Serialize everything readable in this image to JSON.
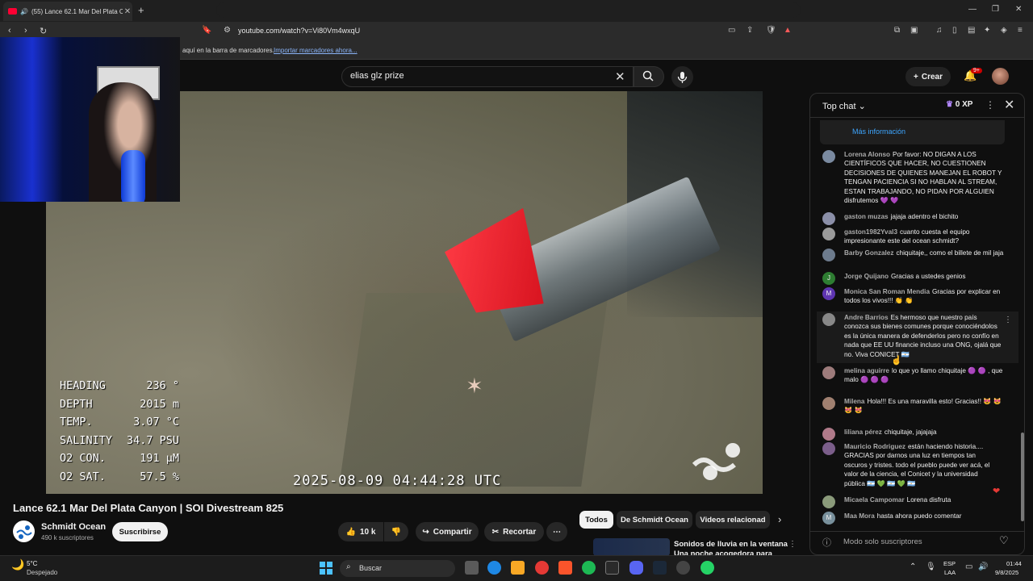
{
  "browser": {
    "tab_title": "(55) Lance 62.1 Mar Del Plata C",
    "url": "youtube.com/watch?v=Vi80Vm4wxqU",
    "bookmarks_text": "aquí en la barra de marcadores.",
    "bookmarks_link": "Importar marcadores ahora..."
  },
  "header": {
    "search_query": "elias glz prize",
    "create_label": "Crear",
    "notifications_badge": "9+"
  },
  "video": {
    "telemetry": [
      {
        "label": "HEADING",
        "value": "236 °"
      },
      {
        "label": "DEPTH",
        "value": "2015 m"
      },
      {
        "label": "TEMP.",
        "value": "3.07 °C"
      },
      {
        "label": "SALINITY",
        "value": "34.7 PSU"
      },
      {
        "label": "O2 CON.",
        "value": "191 µM"
      },
      {
        "label": "O2 SAT.",
        "value": "57.5 %"
      }
    ],
    "timestamp": "2025-08-09 04:44:28 UTC",
    "title": "Lance 62.1 Mar Del Plata Canyon | SOI Divestream 825",
    "channel_name": "Schmidt Ocean",
    "subscribers": "490 k suscriptores",
    "subscribe_label": "Suscribirse",
    "likes": "10 k",
    "share_label": "Compartir",
    "clip_label": "Recortar"
  },
  "chips": [
    "Todos",
    "De Schmidt Ocean",
    "Videos relacionad"
  ],
  "recommended": {
    "title": "Sonidos de lluvia en la ventana",
    "subtitle": "Una noche acogedora para"
  },
  "chat": {
    "title": "Top chat",
    "xp": "0 XP",
    "more_info": "Más información",
    "footer": "Modo solo suscriptores",
    "messages": [
      {
        "author": "Lorena Alonso",
        "text": "Por favor: NO DIGAN A LOS CIENTÍFICOS QUE HACER, NO CUESTIONEN DECISIONES DE QUIENES MANEJAN EL ROBOT Y TENGAN PACIENCIA SI NO HABLAN AL STREAM, ESTAN TRABAJANDO, NO PIDAN POR ALGUIEN disfrutemos 💜 💜",
        "avatar": "#7a8aa0"
      },
      {
        "author": "gaston muzas",
        "text": "jajaja adentro el bichito",
        "avatar": "#8b8fa8"
      },
      {
        "author": "gaston1982Yval3",
        "text": "cuanto cuesta el equipo impresionante este del ocean schmidt?",
        "avatar": "#9a9a9a"
      },
      {
        "author": "Barby Gonzalez",
        "text": "chiquitaje,, como el billete de mil jaja",
        "avatar": "#6d7b8d"
      },
      {
        "author": "Jorge Quijano",
        "text": "Gracias a ustedes genios",
        "avatar": "#2e7d32",
        "initial": "J"
      },
      {
        "author": "Monica San Roman Mendia",
        "text": "Gracias por explicar en todos los vivos!!! 👏 👏",
        "avatar": "#5e35b1",
        "initial": "M"
      },
      {
        "author": "Andre Barrios",
        "text": "Es hermoso que nuestro país conozca sus bienes comunes porque conociéndolos es la única manera de defenderlos pero no confío en nada que EE UU financie incluso una ONG, ojalá que no. Viva CONICET 🇦🇷",
        "avatar": "#888888"
      },
      {
        "author": "melina aguirre",
        "text": "lo que yo llamo chiquitaje 🟣 🟣 , que malo 🟣 🟣 🟣",
        "avatar": "#9d7b7b"
      },
      {
        "author": "Milena",
        "text": "Hola!!! Es una maravilla esto! Gracias!! 😻 😻 😻 😻",
        "avatar": "#a08070"
      },
      {
        "author": "liliana pérez",
        "text": "chiquitaje, jajajaja",
        "avatar": "#b07a8a"
      },
      {
        "author": "Mauricio Rodriguez",
        "text": "están haciendo historia.... GRACIAS por darnos una luz en tiempos tan oscuros y tristes. todo el pueblo puede ver acá, el valor de la ciencia, el Conicet y la universidad pública 🇦🇷 💚 🇦🇷 💚 🇦🇷",
        "avatar": "#7b5e8a"
      },
      {
        "author": "Micaela Campomar",
        "text": "Lorena disfruta",
        "avatar": "#8a9a7a"
      },
      {
        "author": "Maa Mora",
        "text": "hasta ahora puedo comentar",
        "avatar": "#78909c",
        "initial": "M"
      }
    ]
  },
  "taskbar": {
    "temp": "5°C",
    "weather": "Despejado",
    "search_placeholder": "Buscar",
    "lang1": "ESP",
    "lang2": "LAA",
    "time": "01:44",
    "date": "9/8/2025"
  }
}
